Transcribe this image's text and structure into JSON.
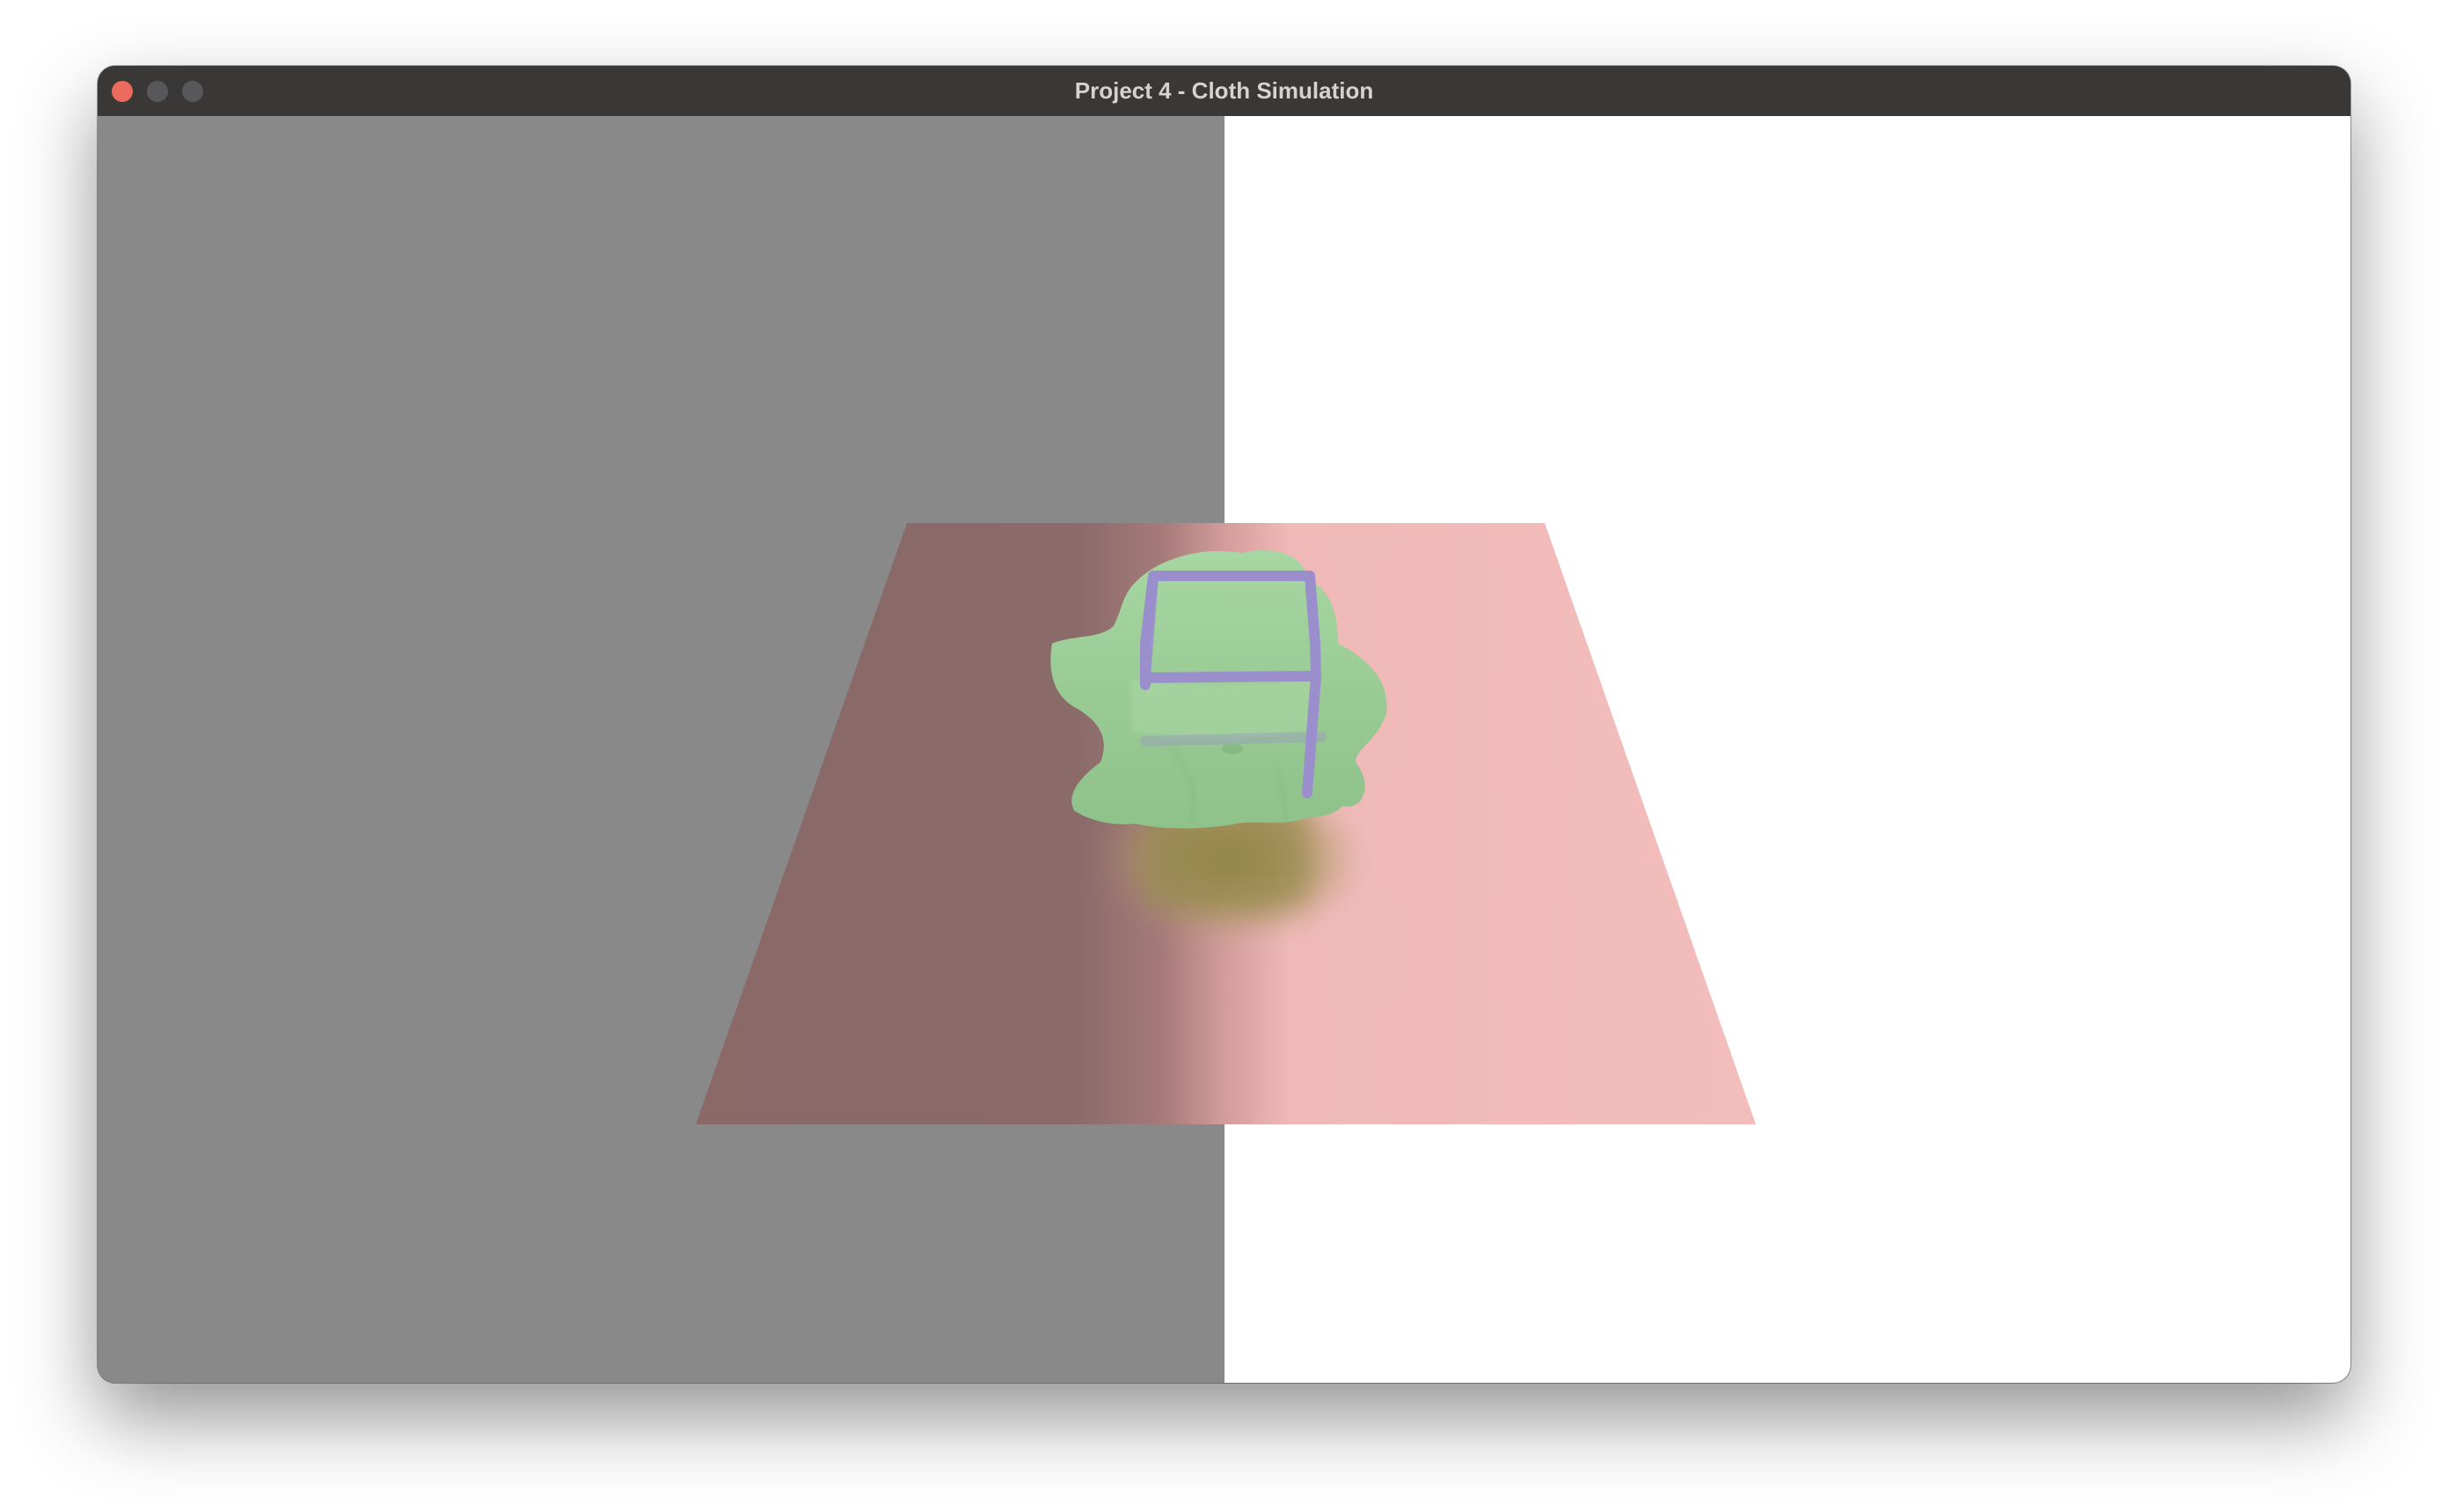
{
  "window": {
    "title": "Project 4 - Cloth Simulation",
    "controls": {
      "close_icon": "close-icon",
      "minimize_icon": "minimize-icon",
      "zoom_icon": "zoom-icon"
    }
  },
  "scene": {
    "colors": {
      "left_background": "#898989",
      "right_background": "#ffffff",
      "plane_shaded": "#886867",
      "plane_lit": "#f2bcbb",
      "cloth": "#9ccd97",
      "cube_wireframe": "#9a8fcc",
      "shadow": "#a29a63"
    }
  }
}
